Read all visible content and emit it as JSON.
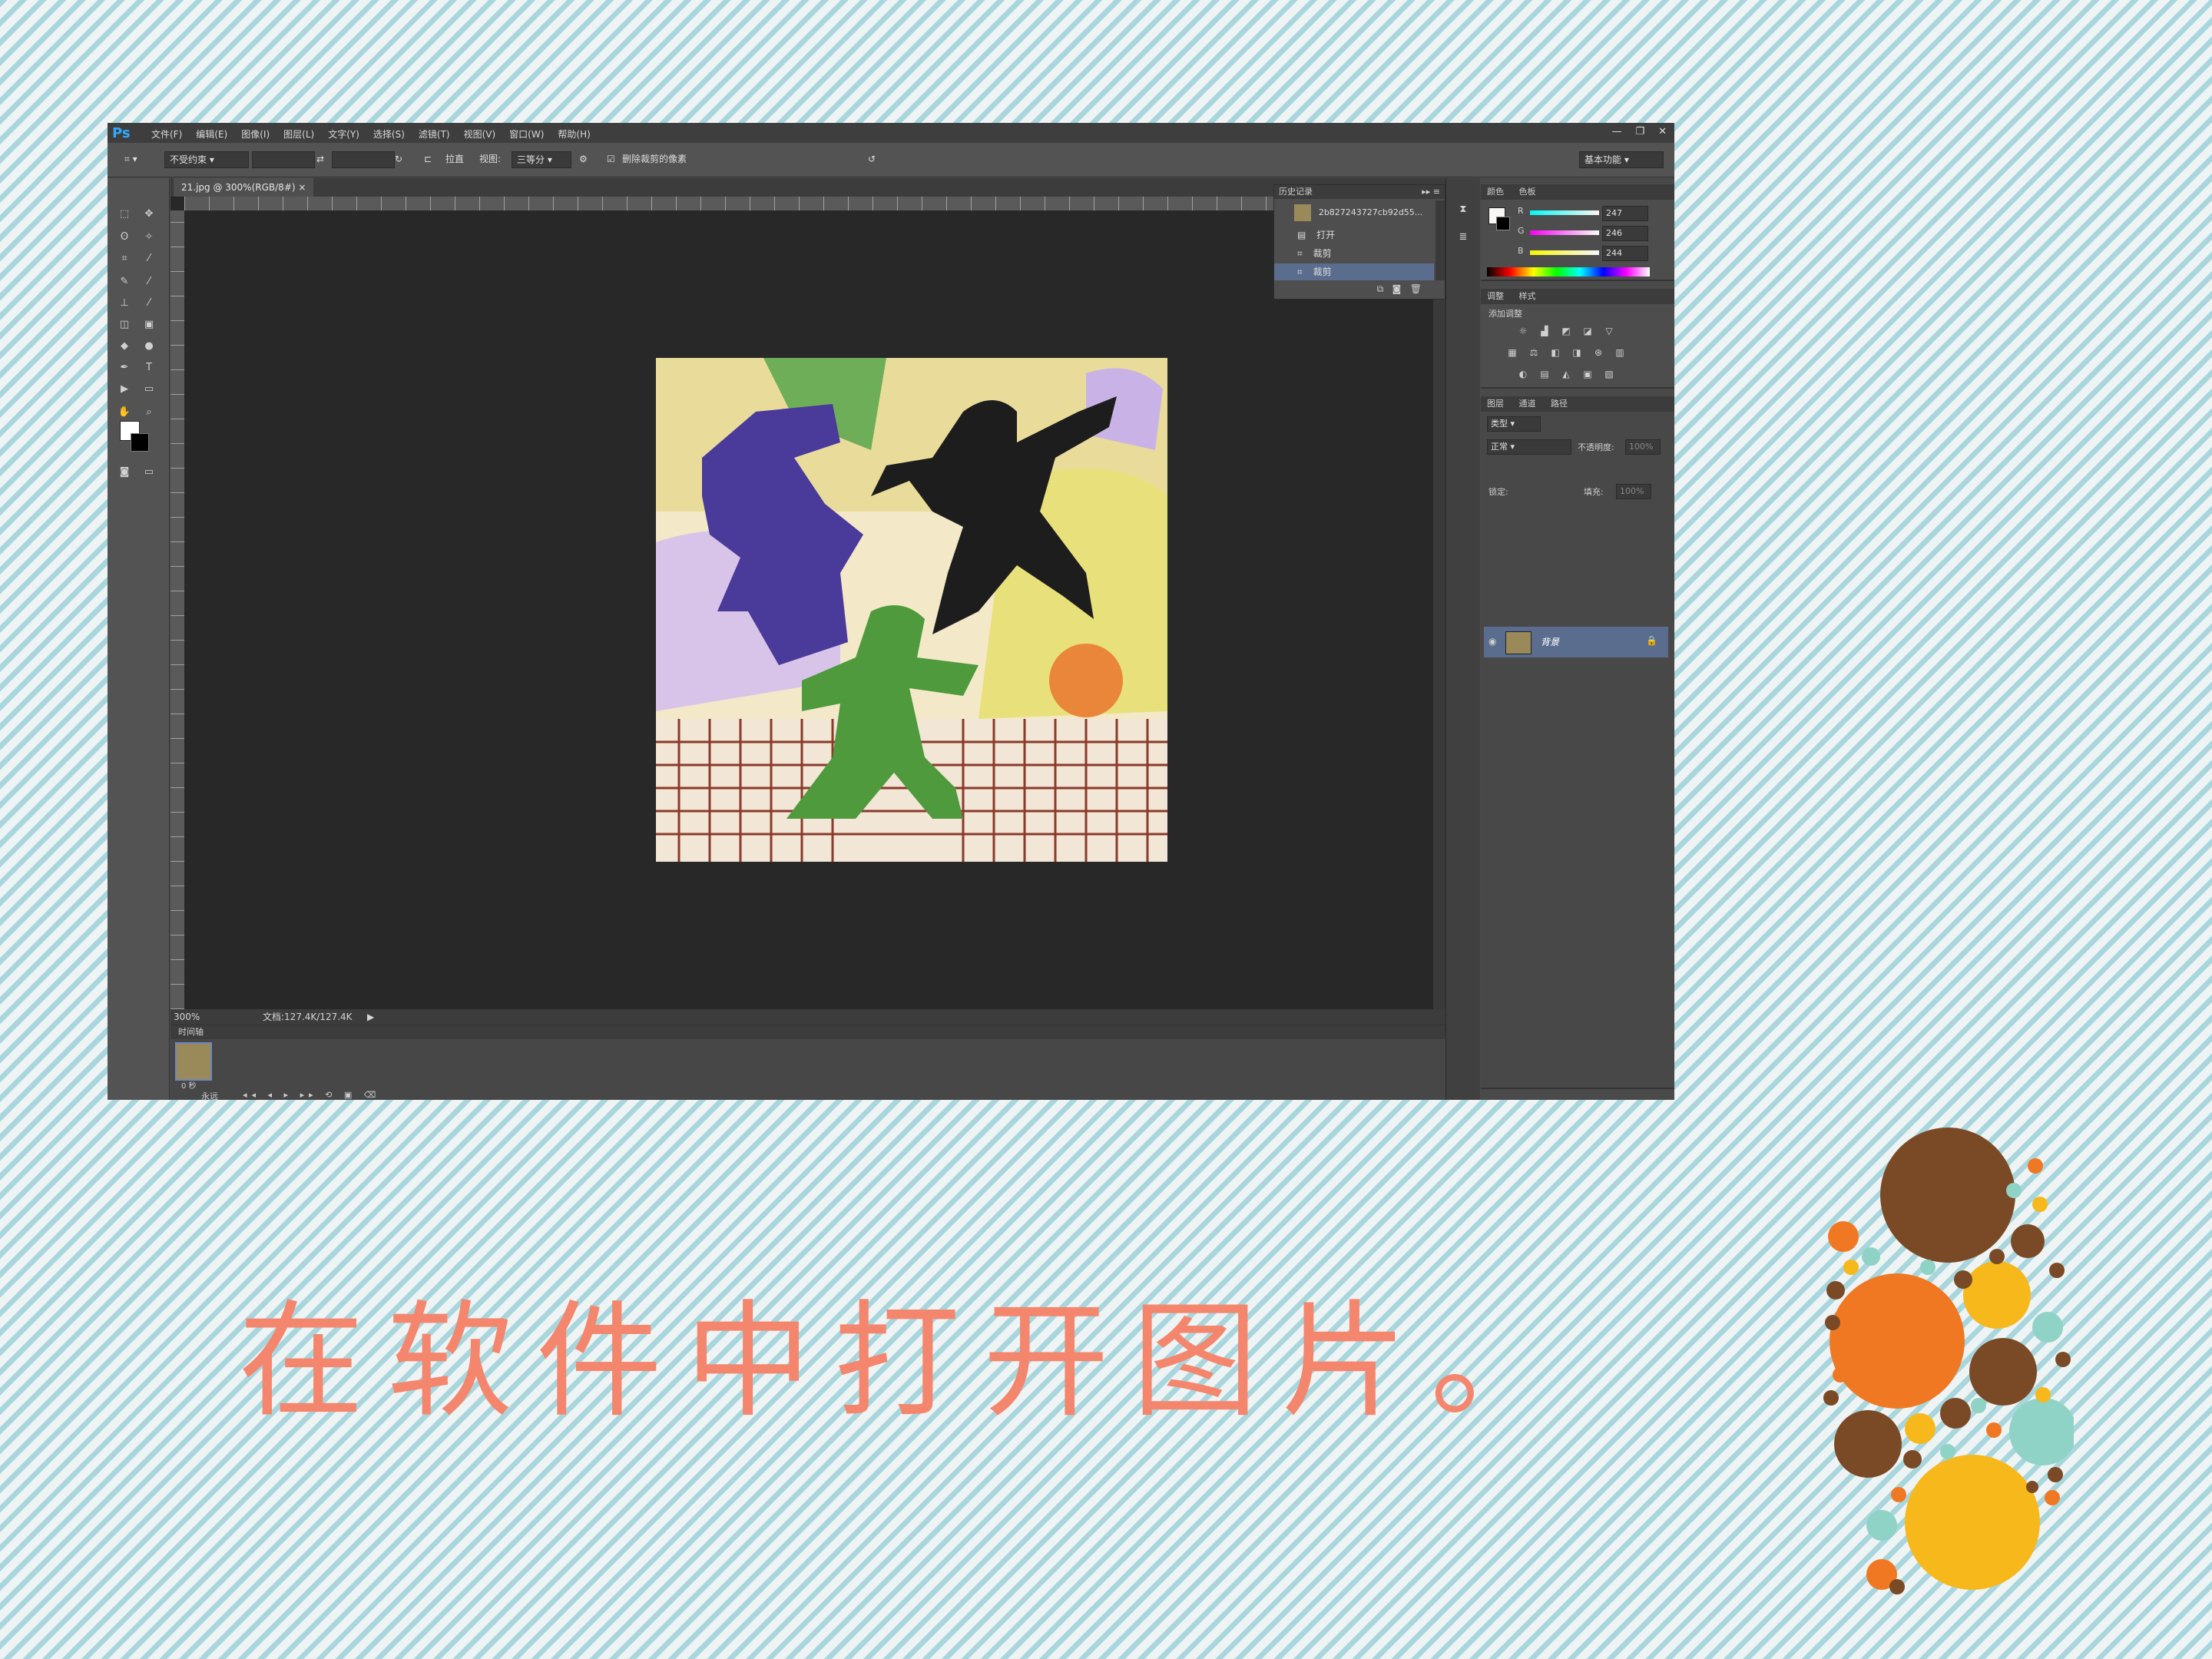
{
  "app": {
    "logo": "Ps",
    "menus": [
      "文件(F)",
      "编辑(E)",
      "图像(I)",
      "图层(L)",
      "文字(Y)",
      "选择(S)",
      "滤镜(T)",
      "视图(V)",
      "窗口(W)",
      "帮助(H)"
    ],
    "window_buttons": [
      "—",
      "❐",
      "✕"
    ]
  },
  "options": {
    "ratio_label": "不受约束",
    "straighten_label": "拉直",
    "view_label": "视图:",
    "view_value": "三等分",
    "delete_pixels_label": "删除裁剪的像素",
    "workspace": "基本功能"
  },
  "document": {
    "tab": "21.jpg @ 300%(RGB/8#)",
    "tab_close": "×",
    "zoom": "300%",
    "doc_size": "文档:127.4K/127.4K"
  },
  "history": {
    "title": "历史记录",
    "snapshot": "2b827243727cb92d55...",
    "items": [
      "打开",
      "裁剪",
      "裁剪"
    ]
  },
  "color_panel": {
    "tabs": [
      "颜色",
      "色板"
    ],
    "channels": [
      {
        "label": "R",
        "value": "247"
      },
      {
        "label": "G",
        "value": "246"
      },
      {
        "label": "B",
        "value": "244"
      }
    ]
  },
  "adjust_panel": {
    "tabs": [
      "调整",
      "样式"
    ],
    "title": "添加调整"
  },
  "layers_panel": {
    "tabs": [
      "图层",
      "通道",
      "路径"
    ],
    "kind": "类型",
    "blend": "正常",
    "opacity_label": "不透明度:",
    "opacity": "100%",
    "lock_label": "锁定:",
    "fill_label": "填充:",
    "fill": "100%",
    "layer_name": "背景"
  },
  "timeline": {
    "title": "时间轴",
    "frame_time": "0 秒",
    "loop": "永远"
  },
  "caption": "在软件中打开图片。",
  "colors": {
    "brown": "#7a4a26",
    "orange": "#f07822",
    "yellow": "#f7b81c",
    "teal": "#8fd2c6",
    "caption": "#f4866e"
  }
}
